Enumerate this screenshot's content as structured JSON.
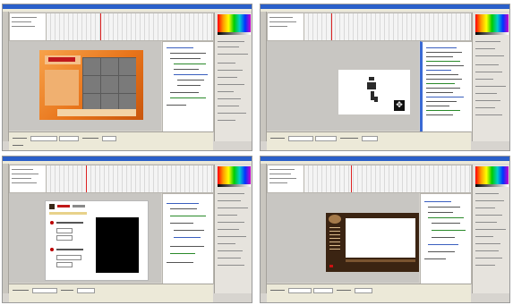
{
  "screenshots": [
    {
      "id": "s1",
      "stage_content": "orange-banner"
    },
    {
      "id": "s2",
      "stage_content": "white-figure"
    },
    {
      "id": "s3",
      "stage_content": "form-with-black-box"
    },
    {
      "id": "s4",
      "stage_content": "brown-website"
    }
  ],
  "colors": {
    "titlebar": "#2a5fc9",
    "panel": "#d7d4cf",
    "banner_orange": "#e8741a",
    "form_bullet": "#b00000",
    "site_brown": "#3b2412",
    "side_scrollbar": "#3a6ad4"
  },
  "icons": {
    "move": "four-way-arrows-icon"
  }
}
